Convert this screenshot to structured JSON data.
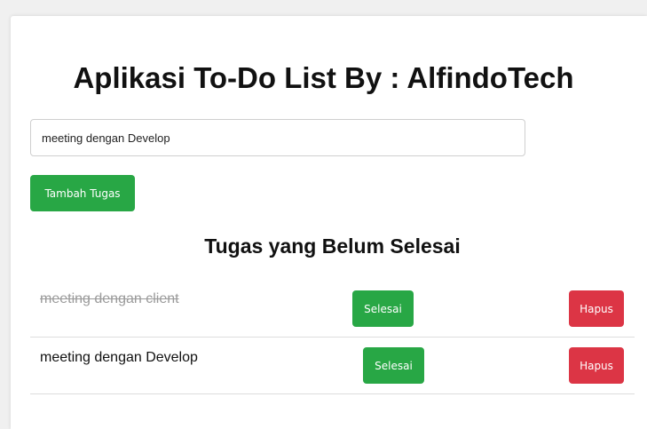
{
  "app": {
    "title": "Aplikasi To-Do List By : AlfindoTech"
  },
  "form": {
    "input_value": "meeting dengan Develop",
    "add_button_label": "Tambah Tugas"
  },
  "list": {
    "heading": "Tugas yang Belum Selesai",
    "tasks": [
      {
        "text": "meeting dengan client",
        "completed": true,
        "done_label": "Selesai",
        "delete_label": "Hapus"
      },
      {
        "text": "meeting dengan Develop",
        "completed": false,
        "done_label": "Selesai",
        "delete_label": "Hapus"
      }
    ]
  },
  "colors": {
    "success": "#28a745",
    "danger": "#dc3545",
    "completed_text": "#9a9a9a"
  }
}
